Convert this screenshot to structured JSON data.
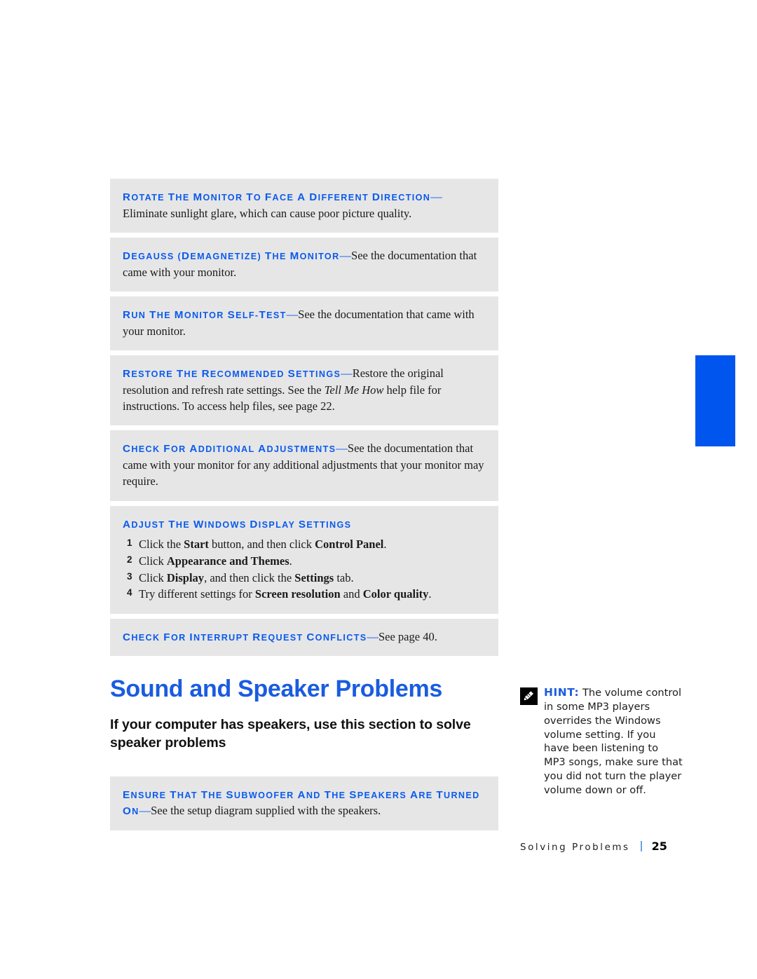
{
  "page": {
    "edge_tab_color": "#0055ee",
    "accent_blue": "#0a5aee",
    "heading_blue": "#1a5ce0",
    "box_gray": "#e6e6e6"
  },
  "tips": [
    {
      "heading": "Rotate the monitor to face a different direction",
      "dash": "—",
      "body": "Eliminate sunlight glare, which can cause poor picture quality."
    },
    {
      "heading": "Degauss (demagnetize) the monitor",
      "dash": "—",
      "body": "See the documentation that came with your monitor."
    },
    {
      "heading": "Run the monitor self-test",
      "dash": "—",
      "body": "See the documentation that came with your monitor."
    },
    {
      "heading": "Restore the recommended settings",
      "dash": "—",
      "body_part1": "Restore the original resolution and refresh rate settings. See the ",
      "body_italic": "Tell Me How",
      "body_part2": " help file for instructions. To access help files, see page 22."
    },
    {
      "heading": "Check for additional adjustments",
      "dash": "—",
      "body": "See the documentation that came with your monitor for any additional adjustments that your monitor may require."
    }
  ],
  "adjust_box": {
    "heading": "Adjust the Windows display settings",
    "steps": [
      {
        "num": "1",
        "parts": [
          {
            "text": "Click the ",
            "bold": false
          },
          {
            "text": "Start",
            "bold": true
          },
          {
            "text": " button, and then click ",
            "bold": false
          },
          {
            "text": "Control Panel",
            "bold": true
          },
          {
            "text": ".",
            "bold": false
          }
        ]
      },
      {
        "num": "2",
        "parts": [
          {
            "text": "Click ",
            "bold": false
          },
          {
            "text": "Appearance and Themes",
            "bold": true
          },
          {
            "text": ".",
            "bold": false
          }
        ]
      },
      {
        "num": "3",
        "parts": [
          {
            "text": "Click ",
            "bold": false
          },
          {
            "text": "Display",
            "bold": true
          },
          {
            "text": ", and then click the ",
            "bold": false
          },
          {
            "text": "Settings",
            "bold": true
          },
          {
            "text": " tab.",
            "bold": false
          }
        ]
      },
      {
        "num": "4",
        "parts": [
          {
            "text": "Try different settings for ",
            "bold": false
          },
          {
            "text": "Screen resolution",
            "bold": true
          },
          {
            "text": " and ",
            "bold": false
          },
          {
            "text": "Color quality",
            "bold": true
          },
          {
            "text": ".",
            "bold": false
          }
        ]
      }
    ]
  },
  "irq_box": {
    "heading": "Check for interrupt request conflicts",
    "dash": "—",
    "body": "See page 40."
  },
  "section": {
    "title": "Sound and Speaker Problems",
    "subtitle": "If your computer has speakers, use this section to solve speaker problems"
  },
  "speaker_tip": {
    "heading": "Ensure that the subwoofer and the speakers are turned on",
    "dash": "—",
    "body": "See the setup diagram supplied with the speakers."
  },
  "hint": {
    "icon": "pencil-note-icon",
    "label": "HINT:",
    "text": "The volume control in some MP3 players overrides the Windows volume setting. If you have been listening to MP3 songs, make sure that you did not turn the player volume down or off."
  },
  "footer": {
    "chapter": "Solving Problems",
    "page_number": "25"
  }
}
